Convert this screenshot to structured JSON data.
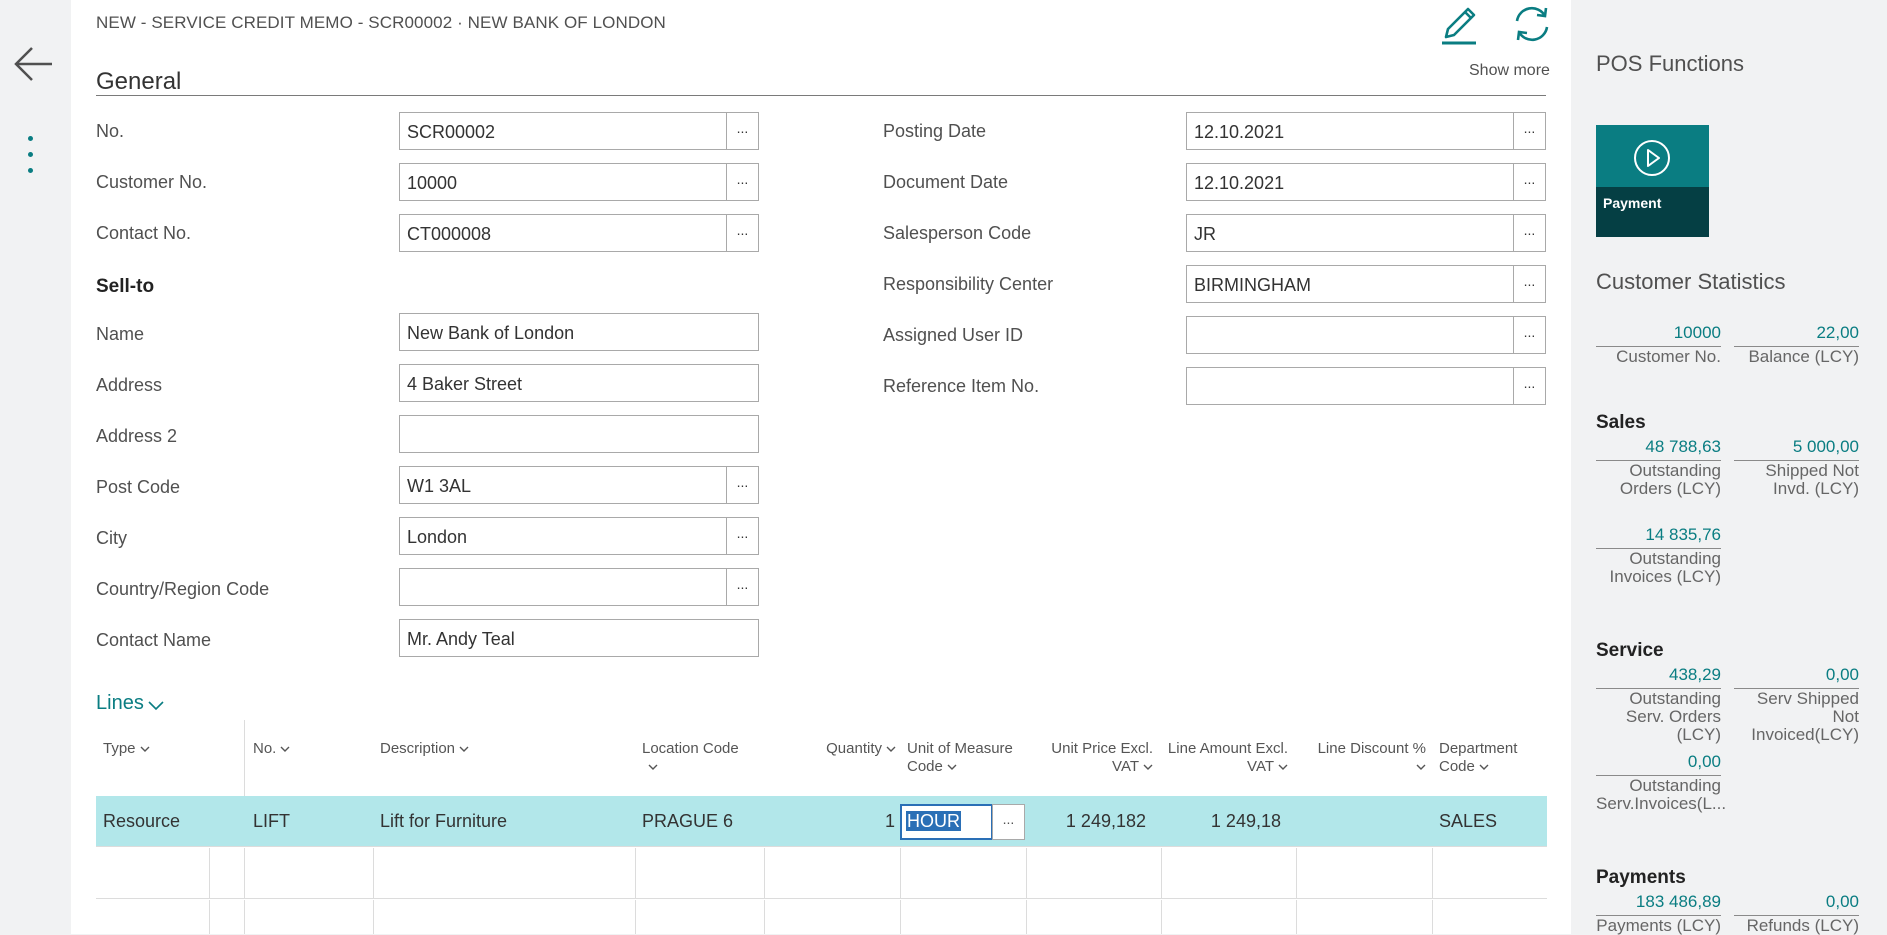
{
  "page": {
    "title": "NEW - SERVICE CREDIT MEMO - SCR00002 · NEW BANK OF LONDON",
    "section": "General",
    "show_more": "Show more",
    "lookup_glyph": "..."
  },
  "general": {
    "left": [
      {
        "label": "No.",
        "value": "SCR00002",
        "lookup": true
      },
      {
        "label": "Customer No.",
        "value": "10000",
        "lookup": true
      },
      {
        "label": "Contact No.",
        "value": "CT000008",
        "lookup": true
      }
    ],
    "sell_to_heading": "Sell-to",
    "sell_to": [
      {
        "label": "Name",
        "value": "New Bank of London",
        "lookup": false
      },
      {
        "label": "Address",
        "value": "4 Baker Street",
        "lookup": false
      },
      {
        "label": "Address 2",
        "value": "",
        "lookup": false
      },
      {
        "label": "Post Code",
        "value": "W1 3AL",
        "lookup": true
      },
      {
        "label": "City",
        "value": "London",
        "lookup": true
      },
      {
        "label": "Country/Region Code",
        "value": "",
        "lookup": true
      },
      {
        "label": "Contact Name",
        "value": "Mr. Andy Teal",
        "lookup": false
      }
    ],
    "right": [
      {
        "label": "Posting Date",
        "value": "12.10.2021",
        "lookup": true
      },
      {
        "label": "Document Date",
        "value": "12.10.2021",
        "lookup": true
      },
      {
        "label": "Salesperson Code",
        "value": "JR",
        "lookup": true
      },
      {
        "label": "Responsibility Center",
        "value": "BIRMINGHAM",
        "lookup": true
      },
      {
        "label": "Assigned User ID",
        "value": "",
        "lookup": true
      },
      {
        "label": "Reference Item No.",
        "value": "",
        "lookup": true
      }
    ]
  },
  "lines": {
    "title": "Lines",
    "columns": [
      {
        "line1": "Type",
        "line2": ""
      },
      {
        "line1": "No.",
        "line2": ""
      },
      {
        "line1": "Description",
        "line2": ""
      },
      {
        "line1": "Location Code",
        "line2": ""
      },
      {
        "line1": "Quantity",
        "line2": ""
      },
      {
        "line1": "Unit of Measure",
        "line2": "Code"
      },
      {
        "line1": "Unit Price Excl.",
        "line2": "VAT"
      },
      {
        "line1": "Line Amount Excl.",
        "line2": "VAT"
      },
      {
        "line1": "Line Discount %",
        "line2": ""
      },
      {
        "line1": "Department",
        "line2": "Code"
      }
    ],
    "rows": [
      {
        "type": "Resource",
        "no": "LIFT",
        "description": "Lift for Furniture",
        "location": "PRAGUE 6",
        "quantity": "1",
        "uom": "HOUR",
        "unit_price": "1 249,182",
        "line_amount": "1 249,18",
        "discount": "",
        "department": "SALES"
      }
    ]
  },
  "factbox": {
    "pos_title": "POS Functions",
    "tile_label": "Payment",
    "stats_title": "Customer Statistics",
    "top": [
      {
        "value": "10000",
        "caption": [
          "Customer No."
        ]
      },
      {
        "value": "22,00",
        "caption": [
          "Balance (LCY)"
        ]
      }
    ],
    "sales_heading": "Sales",
    "sales": [
      {
        "value": "48 788,63",
        "caption": [
          "Outstanding",
          "Orders (LCY)"
        ]
      },
      {
        "value": "5 000,00",
        "caption": [
          "Shipped Not",
          "Invd. (LCY)"
        ]
      },
      {
        "value": "14 835,76",
        "caption": [
          "Outstanding",
          "Invoices (LCY)"
        ]
      }
    ],
    "service_heading": "Service",
    "service": [
      {
        "value": "438,29",
        "caption": [
          "Outstanding",
          "Serv. Orders",
          "(LCY)"
        ]
      },
      {
        "value": "0,00",
        "caption": [
          "Serv Shipped",
          "Not",
          "Invoiced(LCY)"
        ]
      },
      {
        "value": "0,00",
        "caption": [
          "Outstanding",
          "Serv.Invoices(L..."
        ]
      }
    ],
    "payments_heading": "Payments",
    "payments": [
      {
        "value": "183 486,89",
        "caption": [
          "Payments (LCY)"
        ]
      },
      {
        "value": "0,00",
        "caption": [
          "Refunds (LCY)"
        ]
      }
    ]
  },
  "colors": {
    "accent": "#0a7d82",
    "tile_dark": "#053f44",
    "selected_row": "#b2e7ea",
    "focus": "#2a6fb6"
  }
}
